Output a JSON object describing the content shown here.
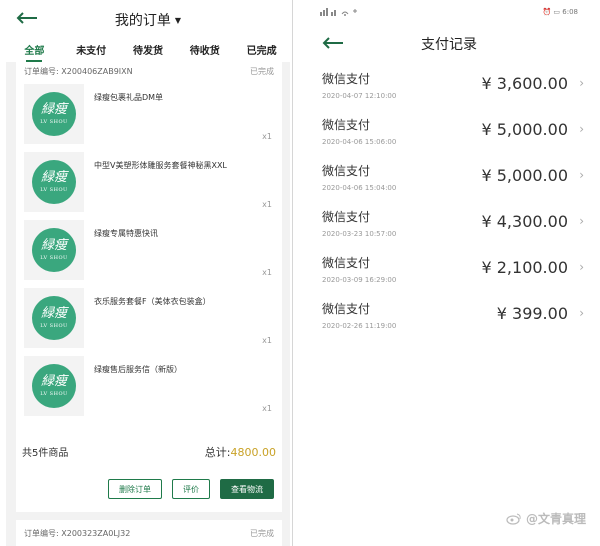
{
  "left": {
    "title": "我的订单",
    "tabs": [
      "全部",
      "未支付",
      "待发货",
      "待收货",
      "已完成"
    ],
    "order1": {
      "label": "订单编号:",
      "number": "X200406ZAB9IXN",
      "status": "已完成"
    },
    "logo": {
      "cn": "緑瘦",
      "en": "LV SHOU"
    },
    "items": [
      {
        "name": "绿瘦包裹礼品DM单",
        "qty": "x1"
      },
      {
        "name": "中型V美塑形体雕服务套餐神秘黑XXL",
        "qty": "x1"
      },
      {
        "name": "绿瘦专属特惠快讯",
        "qty": "x1"
      },
      {
        "name": "衣乐服务套餐F（美体衣包装盒）",
        "qty": "x1"
      },
      {
        "name": "绿瘦售后服务信（新版）",
        "qty": "x1"
      }
    ],
    "count_text": "共5件商品",
    "total_label": "总计:",
    "total_amount": "4800.00",
    "buttons": {
      "delete": "删除订单",
      "review": "评价",
      "logistics": "查看物流"
    },
    "order2": {
      "label": "订单编号:",
      "number": "X200323ZA0LJ32",
      "status": "已完成"
    }
  },
  "right": {
    "status_time": "6:08",
    "title": "支付记录",
    "payments": [
      {
        "name": "微信支付",
        "date": "2020-04-07 12:10:00",
        "amount": "¥ 3,600.00"
      },
      {
        "name": "微信支付",
        "date": "2020-04-06 15:06:00",
        "amount": "¥ 5,000.00"
      },
      {
        "name": "微信支付",
        "date": "2020-04-06 15:04:00",
        "amount": "¥ 5,000.00"
      },
      {
        "name": "微信支付",
        "date": "2020-03-23 10:57:00",
        "amount": "¥ 4,300.00"
      },
      {
        "name": "微信支付",
        "date": "2020-03-09 16:29:00",
        "amount": "¥ 2,100.00"
      },
      {
        "name": "微信支付",
        "date": "2020-02-26 11:19:00",
        "amount": "¥ 399.00"
      }
    ]
  },
  "watermark": "@文青真理"
}
